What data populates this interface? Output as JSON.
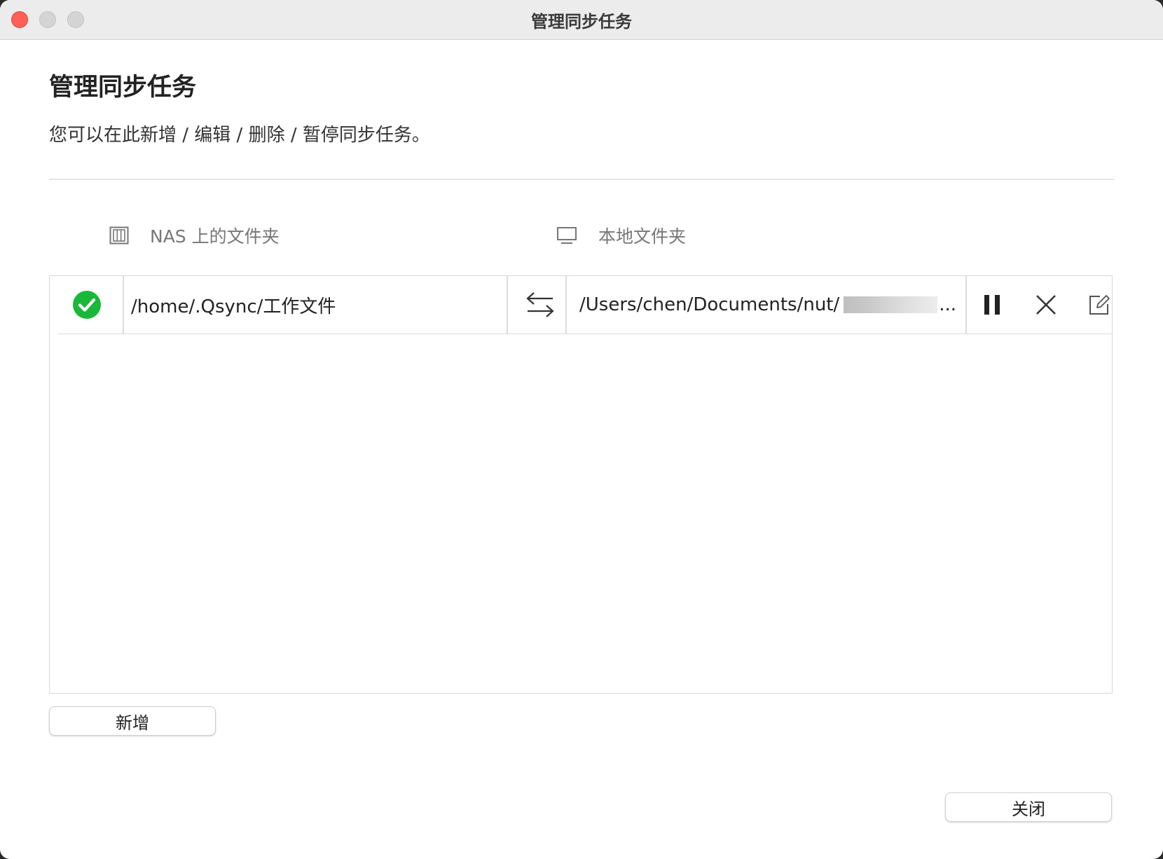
{
  "window": {
    "title": "管理同步任务"
  },
  "header": {
    "title": "管理同步任务",
    "description": "您可以在此新增 / 编辑 / 删除 / 暂停同步任务。"
  },
  "columns": {
    "nas": "NAS 上的文件夹",
    "local": "本地文件夹"
  },
  "tasks": [
    {
      "status": "ok",
      "nas_path": "/home/.Qsync/工作文件",
      "local_path": "/Users/chen/Documents/nut/",
      "local_path_tail": "..."
    }
  ],
  "buttons": {
    "add": "新增",
    "close": "关闭"
  },
  "icons": {
    "status": "green-check-icon",
    "nas": "nas-server-icon",
    "local": "monitor-icon",
    "swap": "bidirectional-arrows-icon",
    "pause": "pause-icon",
    "delete": "close-x-icon",
    "edit": "edit-pencil-icon"
  },
  "colors": {
    "status_ok": "#1ab83a",
    "traffic_close": "#fe5f57"
  }
}
